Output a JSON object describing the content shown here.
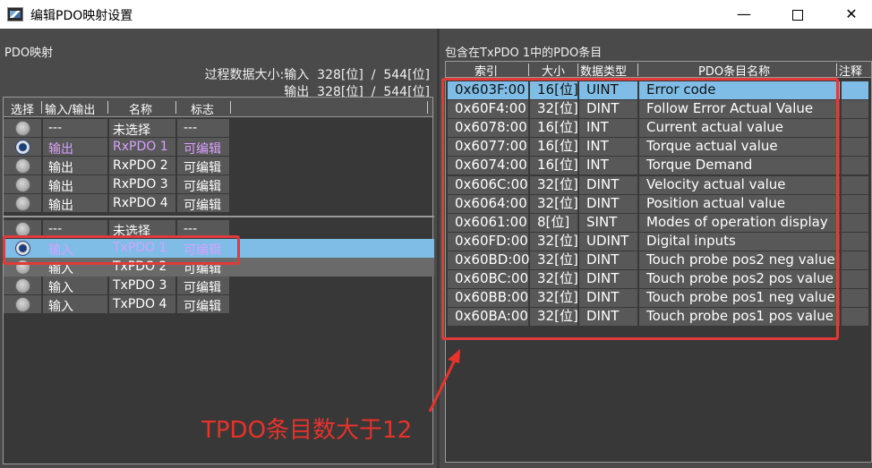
{
  "window": {
    "title": "编辑PDO映射设置",
    "minimize": "—",
    "close": "✕"
  },
  "left": {
    "section_title": "PDO映射",
    "size_line1": "过程数据大小:输入  328[位]  /  544[位]",
    "size_line2": "输出  328[位]  /  544[位]",
    "headers": [
      "选择",
      "输入/输出",
      "名称",
      "标志"
    ],
    "group1": [
      {
        "io": "---",
        "name": "未选择",
        "flag": "---",
        "selected": false,
        "magenta": false
      },
      {
        "io": "输出",
        "name": "RxPDO 1",
        "flag": "可编辑",
        "selected": true,
        "magenta": true
      },
      {
        "io": "输出",
        "name": "RxPDO 2",
        "flag": "可编辑",
        "selected": false,
        "magenta": false
      },
      {
        "io": "输出",
        "name": "RxPDO 3",
        "flag": "可编辑",
        "selected": false,
        "magenta": false
      },
      {
        "io": "输出",
        "name": "RxPDO 4",
        "flag": "可编辑",
        "selected": false,
        "magenta": false
      }
    ],
    "group2": [
      {
        "io": "---",
        "name": "未选择",
        "flag": "---",
        "selected": false,
        "magenta": false
      },
      {
        "io": "输入",
        "name": "TxPDO 1",
        "flag": "可编辑",
        "selected": true,
        "magenta": true
      },
      {
        "io": "输入",
        "name": "TxPDO 2",
        "flag": "可编辑",
        "selected": false,
        "magenta": false
      },
      {
        "io": "输入",
        "name": "TxPDO 3",
        "flag": "可编辑",
        "selected": false,
        "magenta": false
      },
      {
        "io": "输入",
        "name": "TxPDO 4",
        "flag": "可编辑",
        "selected": false,
        "magenta": false
      }
    ]
  },
  "right": {
    "section_title": "包含在TxPDO 1中的PDO条目",
    "headers": [
      "索引",
      "大小",
      "数据类型",
      "PDO条目名称",
      "注释"
    ],
    "entries": [
      {
        "index": "0x603F:00",
        "size": "16[位]",
        "type": "UINT",
        "name": "Error code"
      },
      {
        "index": "0x60F4:00",
        "size": "32[位]",
        "type": "DINT",
        "name": "Follow Error Actual Value"
      },
      {
        "index": "0x6078:00",
        "size": "16[位]",
        "type": "INT",
        "name": "Current actual value"
      },
      {
        "index": "0x6077:00",
        "size": "16[位]",
        "type": "INT",
        "name": "Torque actual value"
      },
      {
        "index": "0x6074:00",
        "size": "16[位]",
        "type": "INT",
        "name": "Torque Demand"
      },
      {
        "index": "0x606C:00",
        "size": "32[位]",
        "type": "DINT",
        "name": "Velocity actual value"
      },
      {
        "index": "0x6064:00",
        "size": "32[位]",
        "type": "DINT",
        "name": "Position actual value"
      },
      {
        "index": "0x6061:00",
        "size": "8[位]",
        "type": "SINT",
        "name": "Modes of operation display"
      },
      {
        "index": "0x60FD:00",
        "size": "32[位]",
        "type": "UDINT",
        "name": "Digital inputs"
      },
      {
        "index": "0x60BD:00",
        "size": "32[位]",
        "type": "DINT",
        "name": "Touch probe pos2 neg value"
      },
      {
        "index": "0x60BC:00",
        "size": "32[位]",
        "type": "DINT",
        "name": "Touch probe pos2 pos value"
      },
      {
        "index": "0x60BB:00",
        "size": "32[位]",
        "type": "DINT",
        "name": "Touch probe pos1 neg value"
      },
      {
        "index": "0x60BA:00",
        "size": "32[位]",
        "type": "DINT",
        "name": "Touch probe pos1 pos value"
      }
    ]
  },
  "annotation": {
    "text": "TPDO条目数大于12",
    "color": "#e8322a"
  }
}
